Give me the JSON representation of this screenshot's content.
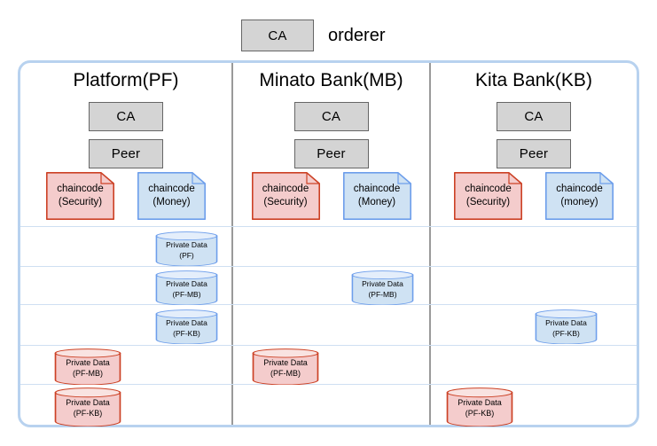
{
  "orderer": {
    "ca_label": "CA",
    "label": "orderer"
  },
  "colors": {
    "panel_border": "#b8d2ef",
    "row_line": "#cfdff2",
    "col_divider": "#9a9a9a",
    "gray_fill": "#d4d4d4",
    "gray_stroke": "#666666",
    "red_fill": "#f4cccc",
    "red_stroke": "#cc4125",
    "blue_fill": "#cfe2f3",
    "blue_stroke": "#6d9eeb"
  },
  "columns": [
    {
      "header": "Platform(PF)",
      "ca_label": "CA",
      "peer_label": "Peer",
      "chaincodes": [
        {
          "line1": "chaincode",
          "line2": "(Security)",
          "color": "red"
        },
        {
          "line1": "chaincode",
          "line2": "(Money)",
          "color": "blue"
        }
      ]
    },
    {
      "header": "Minato Bank(MB)",
      "ca_label": "CA",
      "peer_label": "Peer",
      "chaincodes": [
        {
          "line1": "chaincode",
          "line2": "(Security)",
          "color": "red"
        },
        {
          "line1": "chaincode",
          "line2": "(Money)",
          "color": "blue"
        }
      ]
    },
    {
      "header": "Kita Bank(KB)",
      "ca_label": "CA",
      "peer_label": "Peer",
      "chaincodes": [
        {
          "line1": "chaincode",
          "line2": "(Security)",
          "color": "red"
        },
        {
          "line1": "chaincode",
          "line2": "(money)",
          "color": "blue"
        }
      ]
    }
  ],
  "private_data": [
    {
      "line1": "Private Data",
      "line2": "(PF)",
      "color": "blue",
      "column": 0
    },
    {
      "line1": "Private Data",
      "line2": "(PF-MB)",
      "color": "blue",
      "column": 0
    },
    {
      "line1": "Private Data",
      "line2": "(PF-MB)",
      "color": "blue",
      "column": 1
    },
    {
      "line1": "Private Data",
      "line2": "(PF-KB)",
      "color": "blue",
      "column": 0
    },
    {
      "line1": "Private Data",
      "line2": "(PF-KB)",
      "color": "blue",
      "column": 2
    },
    {
      "line1": "Private Data",
      "line2": "(PF-MB)",
      "color": "red",
      "column": 0
    },
    {
      "line1": "Private Data",
      "line2": "(PF-MB)",
      "color": "red",
      "column": 1
    },
    {
      "line1": "Private Data",
      "line2": "(PF-KB)",
      "color": "red",
      "column": 0
    },
    {
      "line1": "Private Data",
      "line2": "(PF-KB)",
      "color": "red",
      "column": 2
    }
  ]
}
